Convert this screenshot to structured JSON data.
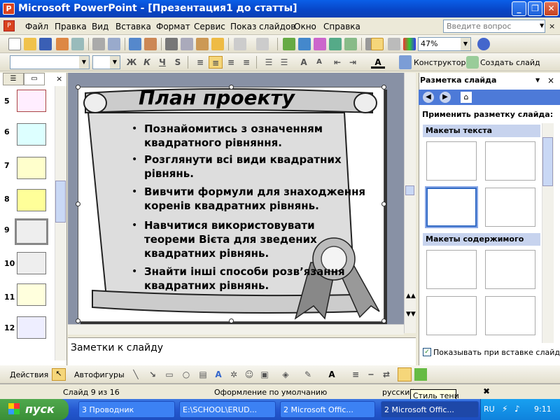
{
  "window": {
    "title": "Microsoft PowerPoint - [Презентация1 до статты]"
  },
  "menu": {
    "items": [
      "Файл",
      "Правка",
      "Вид",
      "Вставка",
      "Формат",
      "Сервис",
      "Показ слайдов",
      "Окно",
      "Справка"
    ],
    "help_placeholder": "Введите вопрос"
  },
  "toolbar": {
    "zoom": "47%",
    "designer_label": "Конструктор",
    "new_slide_label": "Создать слайд"
  },
  "slides_pane": {
    "numbers": [
      "5",
      "6",
      "7",
      "8",
      "9",
      "10",
      "11",
      "12"
    ],
    "selected": "9"
  },
  "slide": {
    "title": "План проекту",
    "bullets": [
      "Познайомитись з означенням квадратного рівняння.",
      "Розглянути всі види квадратних рівнянь.",
      "Вивчити формули для знаходження коренів квадратних рівнянь.",
      "Навчитися використовувати теореми Вієта для зведених квадратних рівнянь.",
      "Знайти інші способи розв’язання квадратних рівнянь."
    ]
  },
  "notes": {
    "placeholder": "Заметки к слайду"
  },
  "task_pane": {
    "title": "Разметка слайда",
    "apply_label": "Применить разметку слайда:",
    "section_text": "Макеты текста",
    "section_content": "Макеты содержимого",
    "show_on_insert_label": "Показывать при вставке слайдов"
  },
  "drawing": {
    "actions_label": "Действия",
    "autoshapes_label": "Автофигуры"
  },
  "status": {
    "slide_info": "Слайд 9 из 16",
    "design": "Оформление по умолчанию",
    "language": "русский"
  },
  "tooltip": {
    "text": "Стиль тени"
  },
  "taskbar": {
    "start": "пуск",
    "tasks": [
      "3 Проводник",
      "E:\\SCHOOL\\ERUD...",
      "2 Microsoft Offic...",
      "2 Microsoft Offic..."
    ],
    "lang": "RU",
    "time": "9:11"
  },
  "colors": {
    "accent": "#316ac5",
    "title_bar": "#0a5fe8",
    "taskbar": "#2558d0"
  }
}
